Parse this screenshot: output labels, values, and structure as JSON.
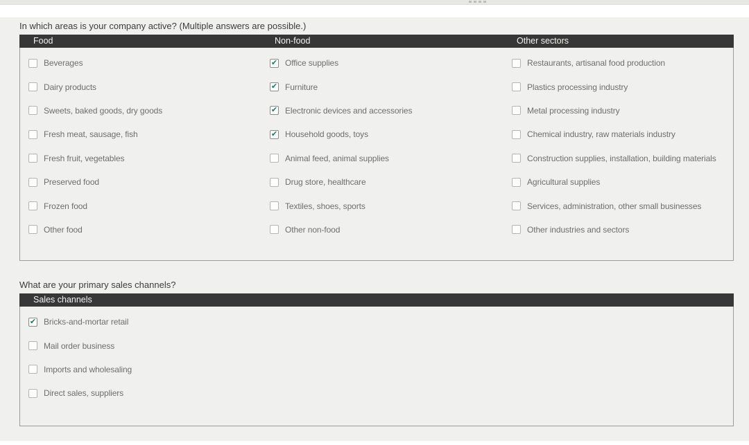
{
  "colors": {
    "header_bg": "#373737",
    "header_text": "#f2f2f1",
    "label_text": "#6e6e6e",
    "question_text": "#3c3c3c",
    "check_color": "#1e7a6a",
    "table_border": "#9c9c9b",
    "panel_bg": "#f0f0ef"
  },
  "icons": {
    "top_drag_dots": "ellipsis-drag-handle"
  },
  "sections": [
    {
      "question": "In which areas is your company active? (Multiple answers are possible.)",
      "columns": [
        {
          "header": "Food",
          "items": [
            {
              "label": "Beverages",
              "checked": false
            },
            {
              "label": "Dairy products",
              "checked": false
            },
            {
              "label": "Sweets, baked goods, dry goods",
              "checked": false
            },
            {
              "label": "Fresh meat, sausage, fish",
              "checked": false
            },
            {
              "label": "Fresh fruit, vegetables",
              "checked": false
            },
            {
              "label": "Preserved food",
              "checked": false
            },
            {
              "label": "Frozen food",
              "checked": false
            },
            {
              "label": "Other food",
              "checked": false
            }
          ]
        },
        {
          "header": "Non-food",
          "items": [
            {
              "label": "Office supplies",
              "checked": true
            },
            {
              "label": "Furniture",
              "checked": true
            },
            {
              "label": "Electronic devices and accessories",
              "checked": true
            },
            {
              "label": "Household goods, toys",
              "checked": true
            },
            {
              "label": "Animal feed, animal supplies",
              "checked": false
            },
            {
              "label": "Drug store, healthcare",
              "checked": false
            },
            {
              "label": "Textiles, shoes, sports",
              "checked": false
            },
            {
              "label": "Other non-food",
              "checked": false
            }
          ]
        },
        {
          "header": "Other sectors",
          "items": [
            {
              "label": "Restaurants, artisanal food production",
              "checked": false
            },
            {
              "label": "Plastics processing industry",
              "checked": false
            },
            {
              "label": "Metal processing industry",
              "checked": false
            },
            {
              "label": "Chemical industry, raw materials industry",
              "checked": false
            },
            {
              "label": "Construction supplies, installation, building materials",
              "checked": false
            },
            {
              "label": "Agricultural supplies",
              "checked": false
            },
            {
              "label": "Services, administration, other small businesses",
              "checked": false
            },
            {
              "label": "Other industries and sectors",
              "checked": false
            }
          ]
        }
      ]
    },
    {
      "question": "What are your primary sales channels?",
      "columns": [
        {
          "header": "Sales channels",
          "items": [
            {
              "label": "Bricks-and-mortar retail",
              "checked": true
            },
            {
              "label": "Mail order business",
              "checked": false
            },
            {
              "label": "Imports and wholesaling",
              "checked": false
            },
            {
              "label": "Direct sales, suppliers",
              "checked": false
            }
          ]
        }
      ]
    }
  ]
}
